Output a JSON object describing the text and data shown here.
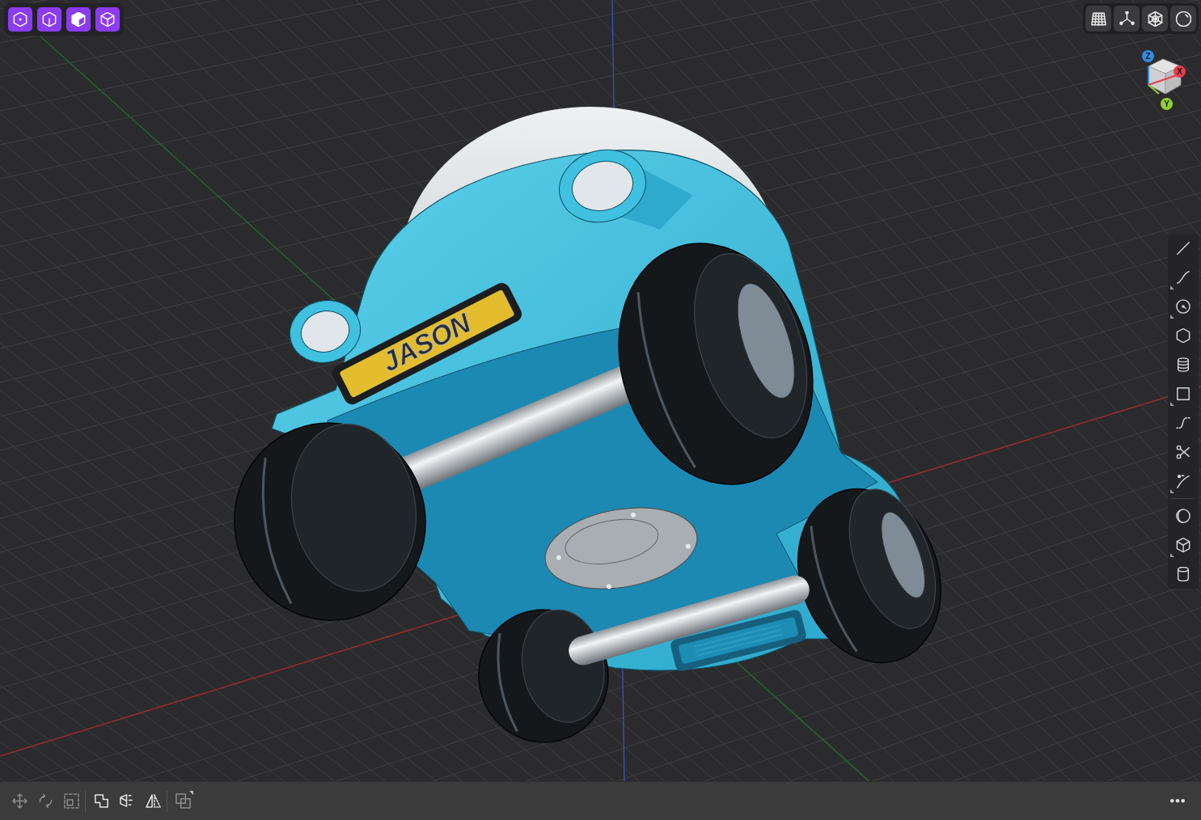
{
  "view_toolbar": {
    "buttons": [
      {
        "kind": "top"
      },
      {
        "kind": "front"
      },
      {
        "kind": "iso"
      },
      {
        "kind": "isowire"
      }
    ]
  },
  "display_toolbar": {
    "buttons": [
      {
        "kind": "grid"
      },
      {
        "kind": "axes"
      },
      {
        "kind": "wireframe"
      },
      {
        "kind": "sphere"
      }
    ]
  },
  "view_cube": {
    "axes": [
      {
        "label": "Z",
        "color": "#2f8de6"
      },
      {
        "label": "X",
        "color": "#ea3a50"
      },
      {
        "label": "Y",
        "color": "#93cf2c"
      }
    ]
  },
  "model": {
    "nameplate": {
      "text": "JASON"
    }
  },
  "sketch_toolbar": {
    "groups": [
      {
        "tools": [
          {
            "kind": "line",
            "flyout": false
          },
          {
            "kind": "curve",
            "flyout": true
          },
          {
            "kind": "circle",
            "flyout": true
          },
          {
            "kind": "hexagon",
            "flyout": false
          },
          {
            "kind": "stack",
            "flyout": false
          },
          {
            "kind": "square",
            "flyout": true
          },
          {
            "kind": "scurve",
            "flyout": false
          },
          {
            "kind": "scissors",
            "flyout": false
          },
          {
            "kind": "trim",
            "flyout": true
          }
        ]
      },
      {
        "tools": [
          {
            "kind": "torus",
            "flyout": false
          },
          {
            "kind": "cube",
            "flyout": true
          },
          {
            "kind": "cylinder",
            "flyout": false
          }
        ]
      }
    ]
  },
  "transform_toolbar": {
    "groups": [
      {
        "tools": [
          {
            "kind": "move",
            "disabled": true,
            "flyout": false
          },
          {
            "kind": "rotate",
            "disabled": true,
            "flyout": false
          },
          {
            "kind": "scale",
            "disabled": true,
            "flyout": false
          }
        ]
      },
      {
        "tools": [
          {
            "kind": "union",
            "disabled": false,
            "flyout": false
          },
          {
            "kind": "project",
            "disabled": false,
            "flyout": false
          },
          {
            "kind": "mirror",
            "disabled": false,
            "flyout": false
          }
        ]
      },
      {
        "tools": [
          {
            "kind": "copy",
            "disabled": true,
            "flyout": true
          }
        ]
      }
    ]
  }
}
